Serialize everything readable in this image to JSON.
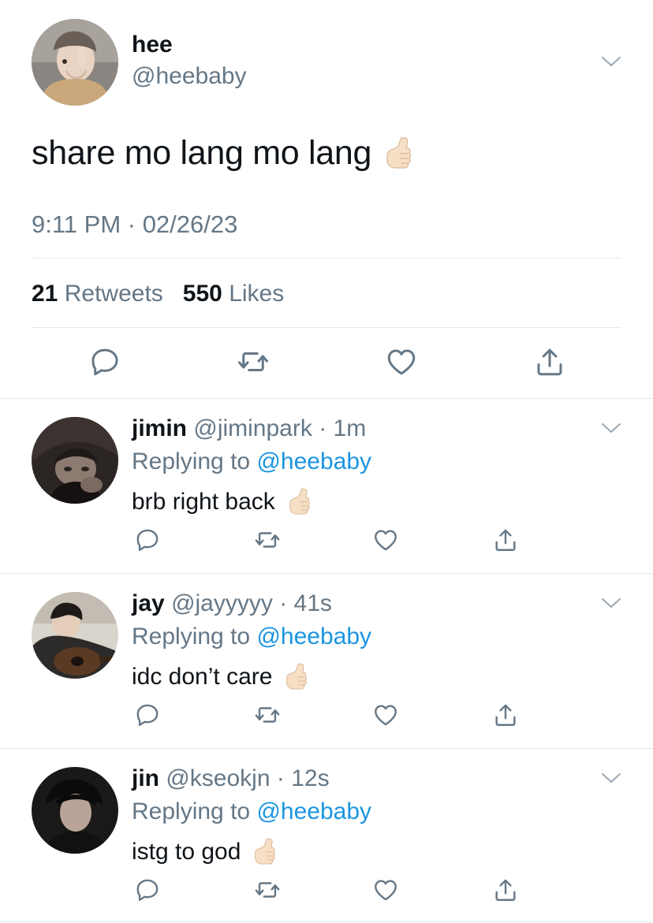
{
  "main_tweet": {
    "name": "hee",
    "handle": "@heebaby",
    "text": "share mo lang mo lang",
    "emoji": "call-me-hand",
    "timestamp": "9:11 PM · 02/26/23",
    "retweets_count": "21",
    "retweets_label": "Retweets",
    "likes_count": "550",
    "likes_label": "Likes"
  },
  "replies": [
    {
      "name": "jimin",
      "handle": "@jiminpark",
      "time": "· 1m",
      "replying_label": "Replying to",
      "replying_to": "@heebaby",
      "text": "brb right back",
      "emoji": "call-me-hand"
    },
    {
      "name": "jay",
      "handle": "@jayyyyy",
      "time": "· 41s",
      "replying_label": "Replying to",
      "replying_to": "@heebaby",
      "text": "idc don’t care",
      "emoji": "call-me-hand"
    },
    {
      "name": "jin",
      "handle": "@kseokjn",
      "time": "· 12s",
      "replying_label": "Replying to",
      "replying_to": "@heebaby",
      "text": "istg to god",
      "emoji": "call-me-hand"
    }
  ],
  "colors": {
    "text": "#0f1419",
    "secondary": "#657786",
    "link": "#1b95e0",
    "divider": "#e1e8ed",
    "icon": "#657786"
  },
  "icons": [
    "chevron-down-icon",
    "reply-icon",
    "retweet-icon",
    "like-icon",
    "share-icon"
  ]
}
